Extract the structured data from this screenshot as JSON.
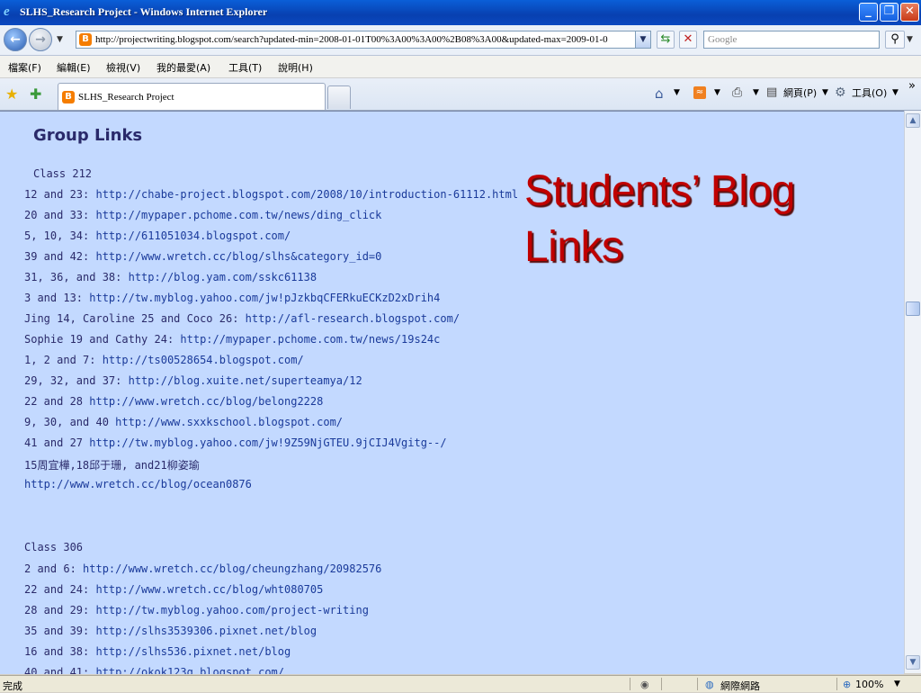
{
  "window": {
    "title": "SLHS_Research Project - Windows Internet Explorer",
    "buttons": {
      "minimize": "_",
      "restore": "❐",
      "close": "✕"
    }
  },
  "address_bar": {
    "url": "http://projectwriting.blogspot.com/search?updated-min=2008-01-01T00%3A00%3A00%2B08%3A00&updated-max=2009-01-0",
    "search_placeholder": "Google"
  },
  "menu": [
    "檔案(F)",
    "編輯(E)",
    "檢視(V)",
    "我的最愛(A)",
    "工具(T)",
    "說明(H)"
  ],
  "tabs": [
    {
      "label": "SLHS_Research Project"
    }
  ],
  "command_bar": {
    "page_label": "網頁(P)",
    "tools_label": "工具(O)",
    "more": "»"
  },
  "page": {
    "heading": "Group Links",
    "overlay_title_line1": "Students’ Blog",
    "overlay_title_line2": "Links",
    "class212": {
      "title": "Class 212",
      "items": [
        {
          "prefix": "12 and 23: ",
          "link": "http://chabe-project.blogspot.com/2008/10/introduction-61112.html"
        },
        {
          "prefix": "20 and 33: ",
          "link": "http://mypaper.pchome.com.tw/news/ding_click"
        },
        {
          "prefix": "5, 10, 34: ",
          "link": "http://611051034.blogspot.com/"
        },
        {
          "prefix": "39 and 42: ",
          "link": "http://www.wretch.cc/blog/slhs&category_id=0"
        },
        {
          "prefix": "31, 36, and 38: ",
          "link": "http://blog.yam.com/sskc61138"
        },
        {
          "prefix": "3 and 13: ",
          "link": "http://tw.myblog.yahoo.com/jw!pJzkbqCFERkuECKzD2xDrih4"
        },
        {
          "prefix": "Jing 14, Caroline 25 and Coco 26: ",
          "link": "http://afl-research.blogspot.com/"
        },
        {
          "prefix": "Sophie 19 and Cathy 24: ",
          "link": "http://mypaper.pchome.com.tw/news/19s24c"
        },
        {
          "prefix": "1, 2 and 7: ",
          "link": "http://ts00528654.blogspot.com/"
        },
        {
          "prefix": "29, 32, and 37: ",
          "link": "http://blog.xuite.net/superteamya/12"
        },
        {
          "prefix": "22 and 28 ",
          "link": "http://www.wretch.cc/blog/belong2228"
        },
        {
          "prefix": "9, 30, and 40 ",
          "link": "http://www.sxxkschool.blogspot.com/"
        },
        {
          "prefix": "41 and 27 ",
          "link": "http://tw.myblog.yahoo.com/jw!9Z59NjGTEU.9jCIJ4Vgitg--/"
        },
        {
          "prefix": "15周宜樺,18邱于珊, and21柳姿瑜",
          "link": ""
        },
        {
          "prefix": "",
          "link": "http://www.wretch.cc/blog/ocean0876"
        }
      ]
    },
    "class306": {
      "title": "Class 306",
      "items": [
        {
          "prefix": "2 and 6: ",
          "link": "http://www.wretch.cc/blog/cheungzhang/20982576"
        },
        {
          "prefix": "22 and 24: ",
          "link": "http://www.wretch.cc/blog/wht080705"
        },
        {
          "prefix": "28 and 29: ",
          "link": "http://tw.myblog.yahoo.com/project-writing"
        },
        {
          "prefix": "35 and 39: ",
          "link": "http://slhs3539306.pixnet.net/blog"
        },
        {
          "prefix": "16 and 38: ",
          "link": "http://slhs536.pixnet.net/blog"
        },
        {
          "prefix": "40 and 41: ",
          "link": "http://okok123g.blogspot.com/"
        }
      ]
    }
  },
  "status_bar": {
    "status": "完成",
    "zone": "網際網路",
    "zoom": "100%"
  }
}
